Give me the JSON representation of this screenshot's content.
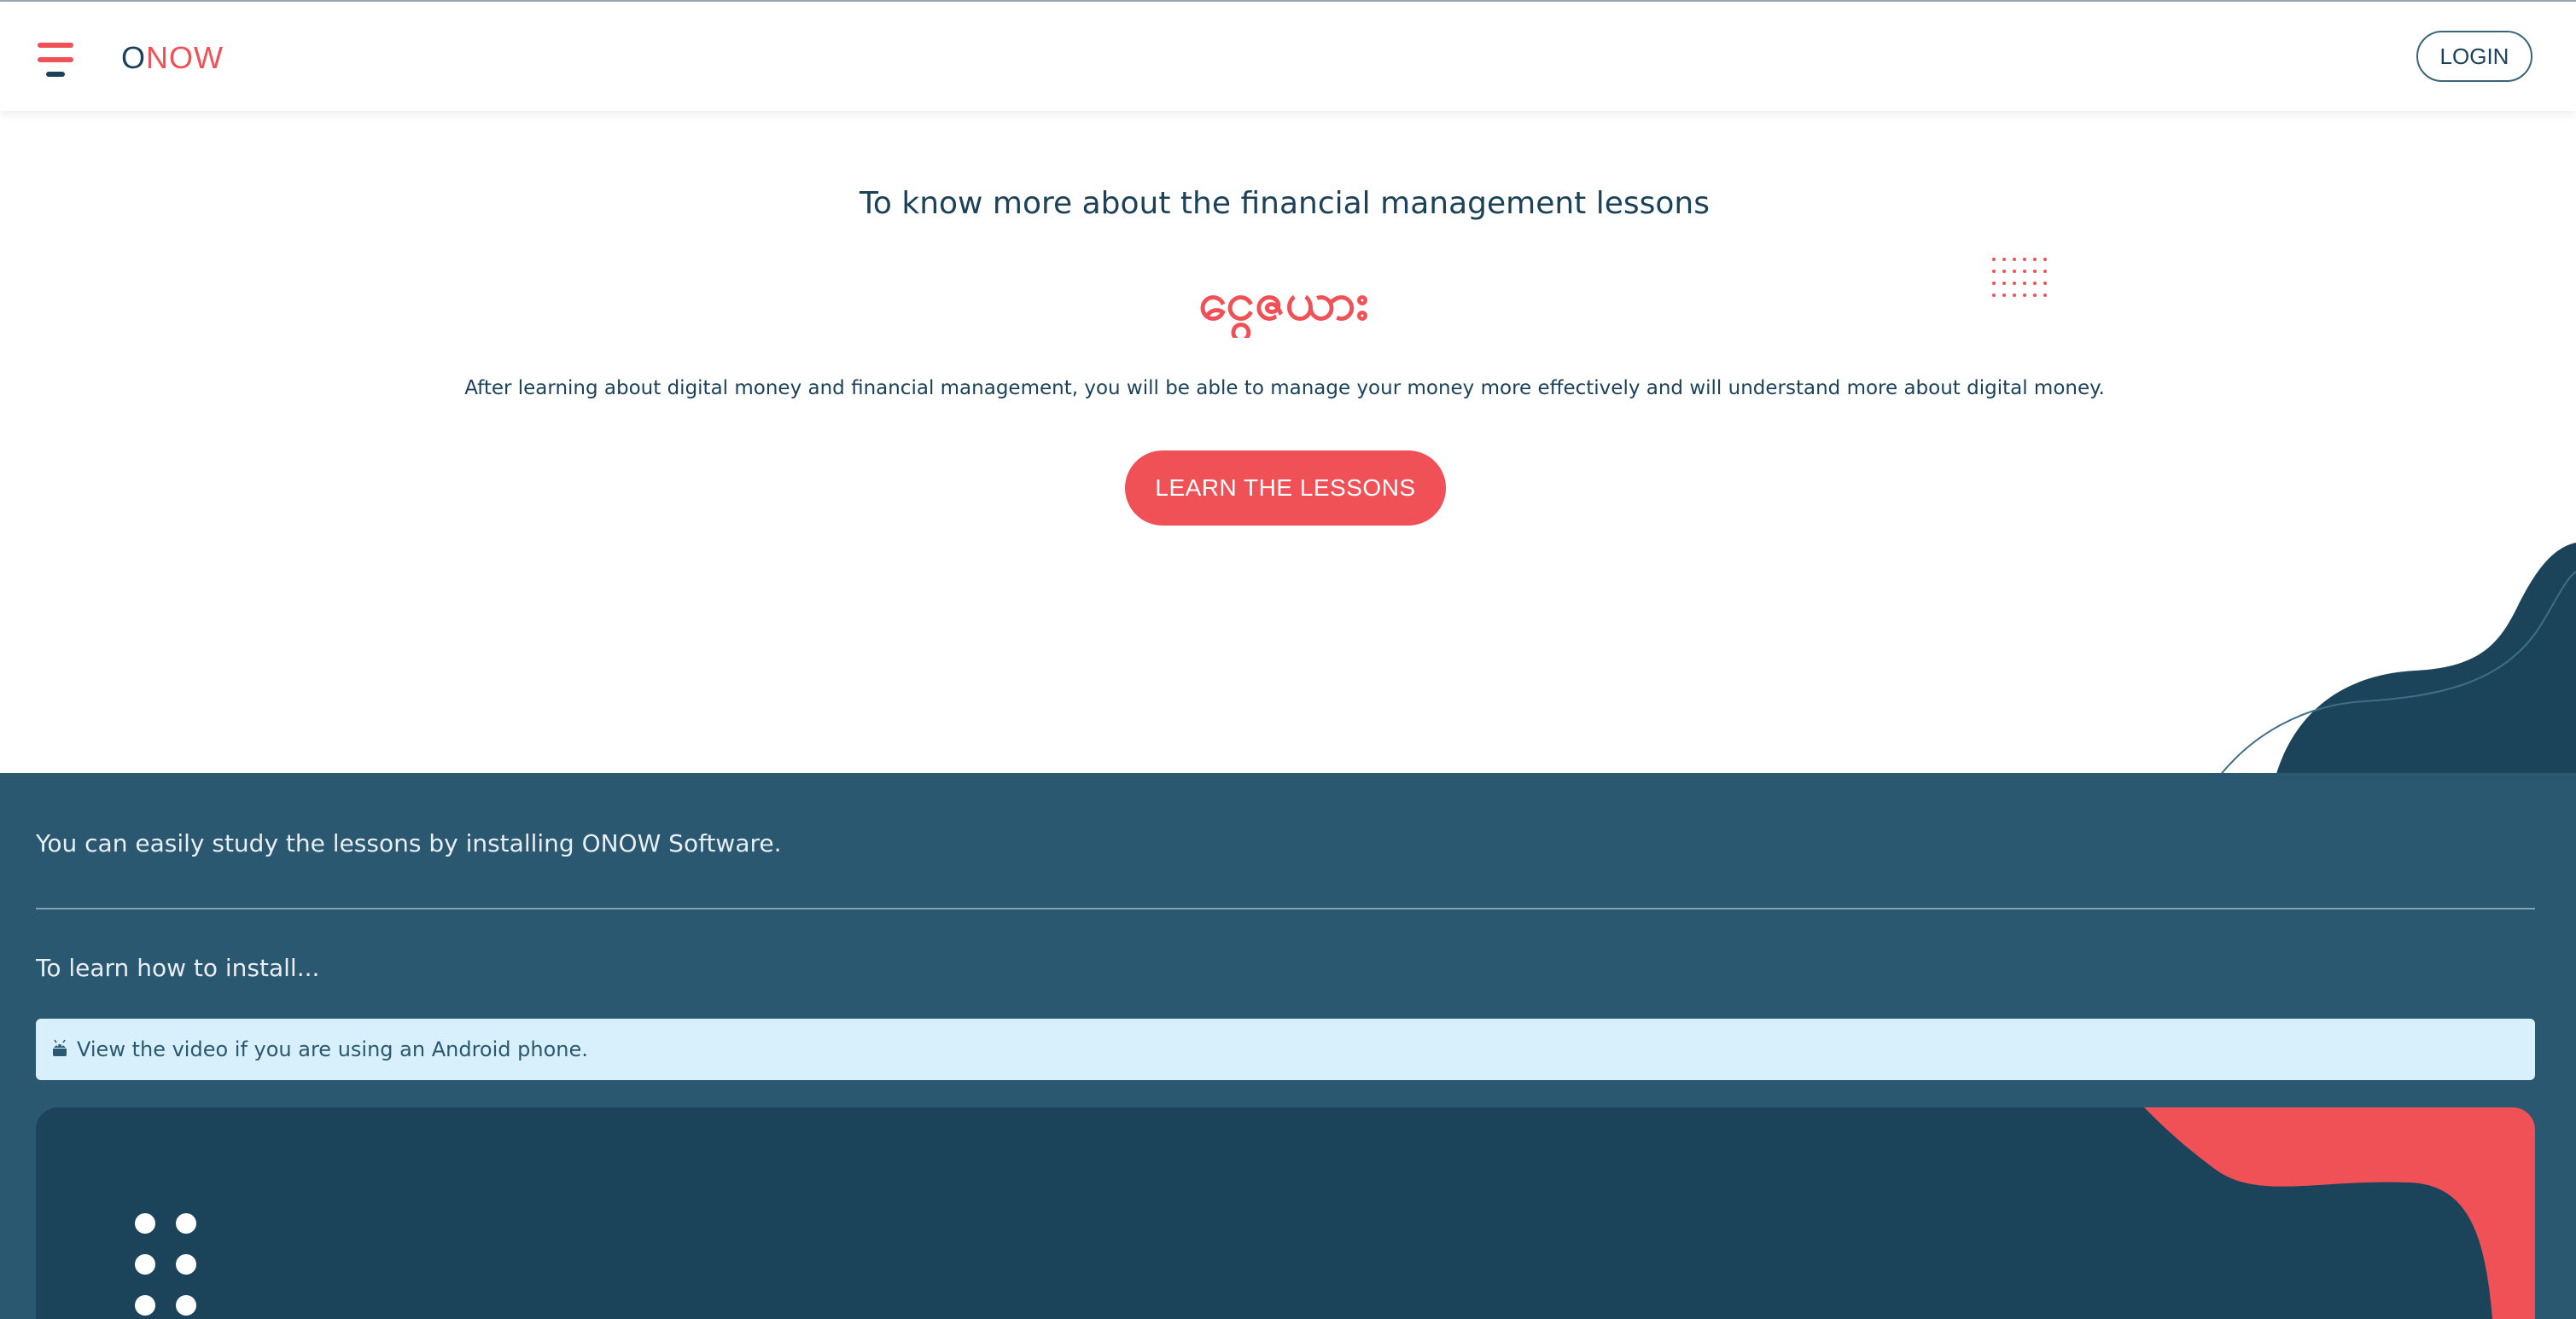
{
  "header": {
    "logo_text_1": "O",
    "logo_text_2": "N",
    "logo_text_3": "O",
    "logo_text_4": "W",
    "login_label": "LOGIN"
  },
  "hero": {
    "title": "To know more about the financial management lessons",
    "myanmar_logo_text": "ငွေဇယား",
    "description": "After learning about digital money and financial management, you will be able to manage your money more effectively and will understand more about digital money.",
    "cta_label": "LEARN THE LESSONS"
  },
  "install": {
    "intro": "You can easily study the lessons by installing ONOW Software.",
    "how_to": "To learn how to install...",
    "android_note": "View the video if you are using an Android phone."
  },
  "colors": {
    "brand_red": "#ef5157",
    "brand_navy": "#1c4259",
    "band_blue": "#2b5871",
    "info_bg": "#d8f0fb"
  },
  "icons": {
    "menu": "hamburger-icon",
    "android": "android-icon"
  }
}
